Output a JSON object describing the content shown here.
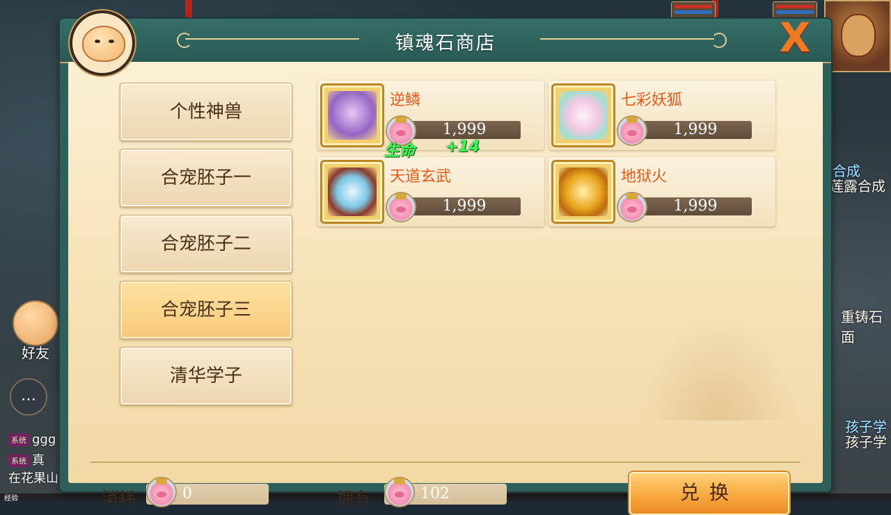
{
  "shop": {
    "title": "镇魂石商店",
    "close_label": "X"
  },
  "categories": [
    {
      "label": "个性神兽",
      "active": false
    },
    {
      "label": "合宠胚子一",
      "active": false
    },
    {
      "label": "合宠胚子二",
      "active": false
    },
    {
      "label": "合宠胚子三",
      "active": true
    },
    {
      "label": "清华学子",
      "active": false
    }
  ],
  "items": [
    {
      "name": "逆鳞",
      "price": "1,999",
      "art_color": "#b98bd8"
    },
    {
      "name": "七彩妖狐",
      "price": "1,999",
      "art_color": "#e9d3f0"
    },
    {
      "name": "天道玄武",
      "price": "1,999",
      "art_color": "#6fbcd6"
    },
    {
      "name": "地狱火",
      "price": "1,999",
      "art_color": "#e0a020"
    }
  ],
  "floating_stat": {
    "label": "生命",
    "value": "+14"
  },
  "footer": {
    "cost_label": "消耗",
    "cost_value": "0",
    "owned_label": "拥有",
    "owned_value": "102",
    "exchange_label": "兑换"
  },
  "background": {
    "friend_label": "好友",
    "chat_icon": "…",
    "chat_lines": [
      {
        "tag": "系统",
        "text": "ggg"
      },
      {
        "tag": "系统",
        "text": "真"
      },
      {
        "tag": "",
        "text": "在花果山"
      }
    ],
    "right_texts": [
      "合成",
      "莲露合成",
      "重铸石面",
      "孩子学",
      "孩子学"
    ],
    "exp_label": "经验"
  },
  "colors": {
    "panel_teal": "#2f5f5a",
    "parchment": "#f6e2b6",
    "item_name": "#e8591a",
    "exchange_orange": "#f7a53b"
  }
}
